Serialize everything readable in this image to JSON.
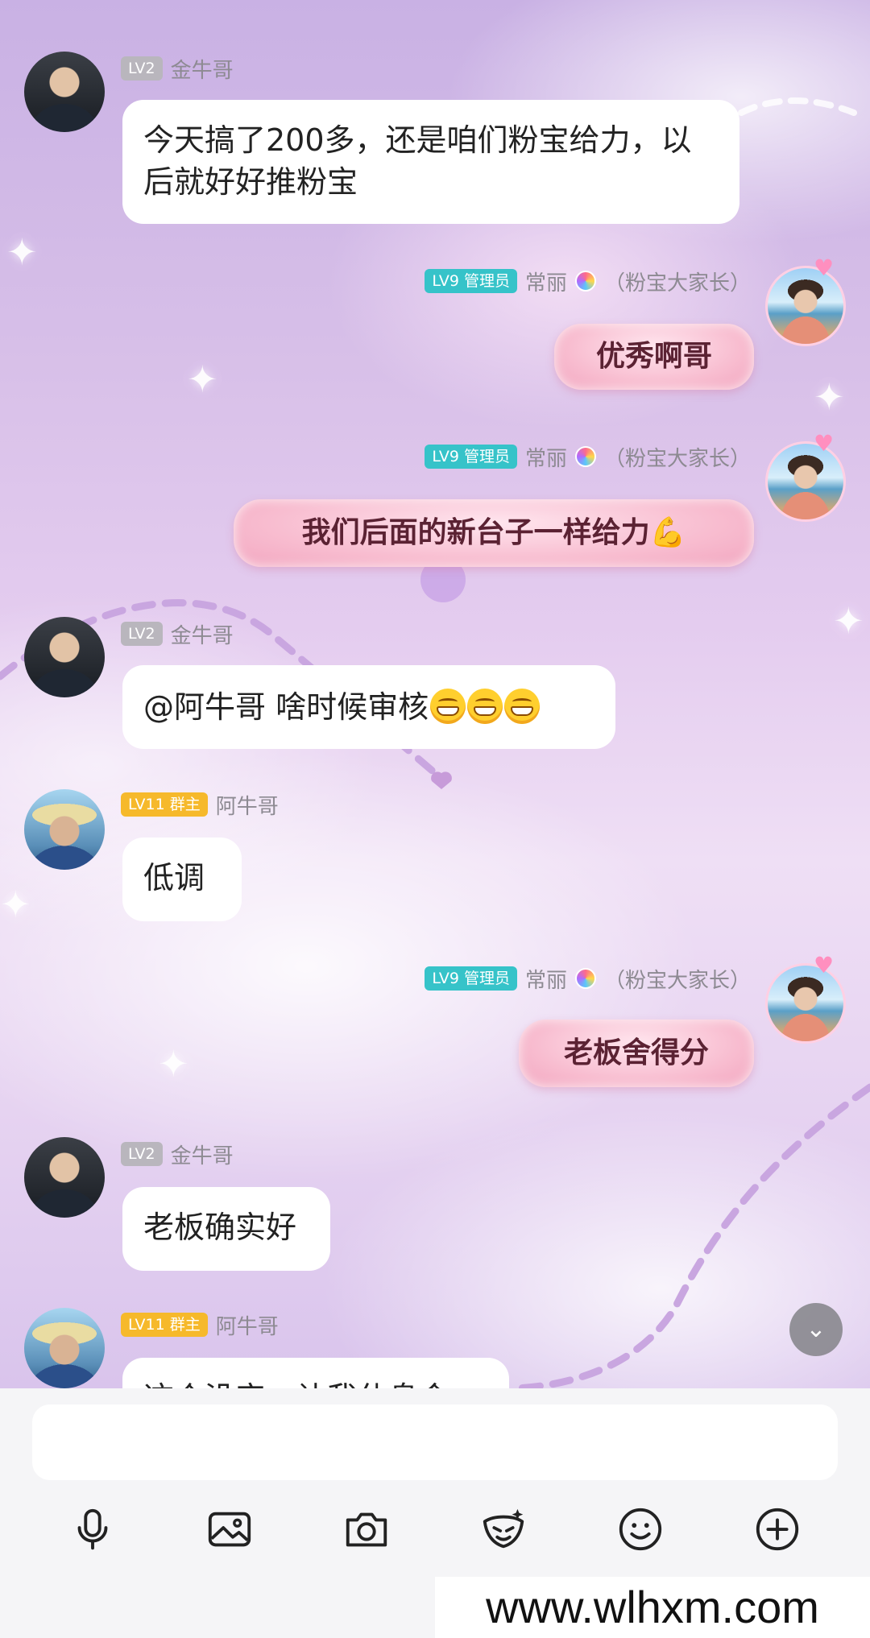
{
  "messages": [
    {
      "id": "m1",
      "side": "left",
      "avatar": "man-in-suit-avatar",
      "badge": "LV2",
      "name": "金牛哥",
      "text": "今天搞了200多，还是咱们粉宝给力，以后就好好推粉宝"
    },
    {
      "id": "m2",
      "side": "right",
      "avatar": "woman-beach-avatar",
      "badge": "LV9 管理员",
      "name": "常丽",
      "name_suffix": "（粉宝大家长）",
      "text": "优秀啊哥"
    },
    {
      "id": "m3",
      "side": "right",
      "avatar": "woman-beach-avatar",
      "badge": "LV9 管理员",
      "name": "常丽",
      "name_suffix": "（粉宝大家长）",
      "text": "我们后面的新台子一样给力",
      "emoji": "flexed-biceps"
    },
    {
      "id": "m4",
      "side": "left",
      "avatar": "man-in-suit-avatar",
      "badge": "LV2",
      "name": "金牛哥",
      "text": "@阿牛哥 啥时候审核",
      "emoji": "grinning-face x3"
    },
    {
      "id": "m5",
      "side": "left",
      "avatar": "man-in-hat-avatar",
      "badge": "LV11 群主",
      "name": "阿牛哥",
      "text": "低调"
    },
    {
      "id": "m6",
      "side": "right",
      "avatar": "woman-beach-avatar",
      "badge": "LV9 管理员",
      "name": "常丽",
      "name_suffix": "（粉宝大家长）",
      "text": "老板舍得分"
    },
    {
      "id": "m7",
      "side": "left",
      "avatar": "man-in-suit-avatar",
      "badge": "LV2",
      "name": "金牛哥",
      "text": "老板确实好"
    },
    {
      "id": "m8",
      "side": "left",
      "avatar": "man-in-hat-avatar",
      "badge": "LV11 群主",
      "name": "阿牛哥",
      "text": "这个没实，让我休息会"
    }
  ],
  "colors": {
    "badge_gray": "#b9b6bd",
    "badge_teal": "#36c3c9",
    "badge_gold": "#f6b92b",
    "pink_bubble": "#f8bdd0",
    "input_bg": "#f5f5f7"
  },
  "input": {
    "value": "",
    "placeholder": ""
  },
  "toolbar": [
    "microphone-icon",
    "image-icon",
    "camera-icon",
    "sticker-icon",
    "emoji-icon",
    "plus-icon"
  ],
  "watermark": "www.wlhxm.com"
}
